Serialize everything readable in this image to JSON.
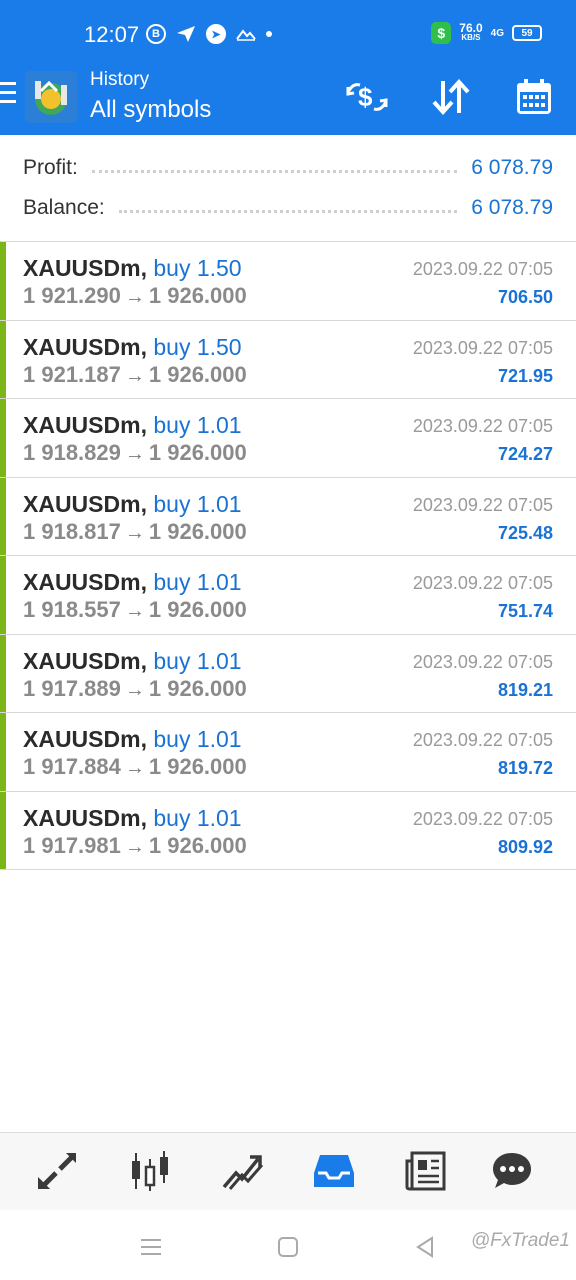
{
  "status_bar": {
    "time": "12:07",
    "icons_left": [
      "b-circle-icon",
      "send-icon",
      "telegram-icon",
      "mountain-icon",
      "dot-icon"
    ],
    "speed_value": "76.0",
    "speed_unit": "KB/S",
    "network": "4G",
    "battery": "59"
  },
  "app_bar": {
    "subtitle": "History",
    "title": "All symbols",
    "actions": [
      "currency-exchange-icon",
      "sort-icon",
      "calendar-icon"
    ]
  },
  "summary": {
    "profit_label": "Profit:",
    "profit_value": "6 078.79",
    "balance_label": "Balance:",
    "balance_value": "6 078.79"
  },
  "deals": [
    {
      "symbol": "XAUUSDm,",
      "side": "buy 1.50",
      "open": "1 921.290",
      "arrow": "→",
      "close": "1 926.000",
      "time": "2023.09.22 07:05",
      "profit": "706.50"
    },
    {
      "symbol": "XAUUSDm,",
      "side": "buy 1.50",
      "open": "1 921.187",
      "arrow": "→",
      "close": "1 926.000",
      "time": "2023.09.22 07:05",
      "profit": "721.95"
    },
    {
      "symbol": "XAUUSDm,",
      "side": "buy 1.01",
      "open": "1 918.829",
      "arrow": "→",
      "close": "1 926.000",
      "time": "2023.09.22 07:05",
      "profit": "724.27"
    },
    {
      "symbol": "XAUUSDm,",
      "side": "buy 1.01",
      "open": "1 918.817",
      "arrow": "→",
      "close": "1 926.000",
      "time": "2023.09.22 07:05",
      "profit": "725.48"
    },
    {
      "symbol": "XAUUSDm,",
      "side": "buy 1.01",
      "open": "1 918.557",
      "arrow": "→",
      "close": "1 926.000",
      "time": "2023.09.22 07:05",
      "profit": "751.74"
    },
    {
      "symbol": "XAUUSDm,",
      "side": "buy 1.01",
      "open": "1 917.889",
      "arrow": "→",
      "close": "1 926.000",
      "time": "2023.09.22 07:05",
      "profit": "819.21"
    },
    {
      "symbol": "XAUUSDm,",
      "side": "buy 1.01",
      "open": "1 917.884",
      "arrow": "→",
      "close": "1 926.000",
      "time": "2023.09.22 07:05",
      "profit": "819.72"
    },
    {
      "symbol": "XAUUSDm,",
      "side": "buy 1.01",
      "open": "1 917.981",
      "arrow": "→",
      "close": "1 926.000",
      "time": "2023.09.22 07:05",
      "profit": "809.92"
    }
  ],
  "bottom_nav": [
    "quotes-icon",
    "chart-icon",
    "trade-icon",
    "history-icon",
    "news-icon",
    "chat-icon"
  ],
  "system_nav": [
    "menu-icon",
    "home-icon",
    "back-icon"
  ],
  "watermark": "@FxTrade1",
  "colors": {
    "accent": "#1a7ce8",
    "profit_blue": "#1a73d4",
    "buy_bar": "#7cb518"
  }
}
